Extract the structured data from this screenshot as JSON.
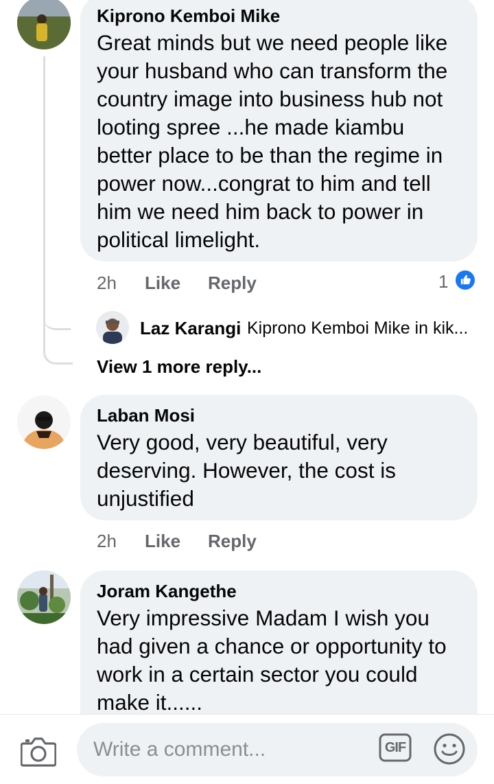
{
  "comments": [
    {
      "author": "Kiprono Kemboi Mike",
      "text": "Great minds but we need people like\nyour husband who can transform the\ncountry image into business hub not\nlooting spree ...he made kiambu\nbetter place to be than the regime in\npower now...congrat to him and tell\nhim we need him back to power in\npolitical limelight.",
      "time": "2h",
      "like_label": "Like",
      "reply_label": "Reply",
      "reaction_count": "1",
      "reaction_icon": "like-icon",
      "reply_preview": {
        "author": "Laz Karangi",
        "text": "Kiprono Kemboi Mike in kik..."
      },
      "view_more_label": "View 1 more reply..."
    },
    {
      "author": "Laban Mosi",
      "text": "Very good, very beautiful, very\ndeserving. However, the cost is\nunjustified",
      "time": "2h",
      "like_label": "Like",
      "reply_label": "Reply"
    },
    {
      "author": "Joram Kangethe",
      "text": "Very impressive Madam I wish you\nhad given a chance or opportunity to\nwork in a certain sector you could\nmake it......"
    }
  ],
  "composer": {
    "placeholder": "Write a comment...",
    "camera_icon": "camera-icon",
    "gif_label": "GIF",
    "emoji_icon": "emoji-icon"
  },
  "colors": {
    "bubble": "#eff2f5",
    "meta_text": "#65676b",
    "like_blue": "#1877f2",
    "thread_line": "#dadde1"
  }
}
